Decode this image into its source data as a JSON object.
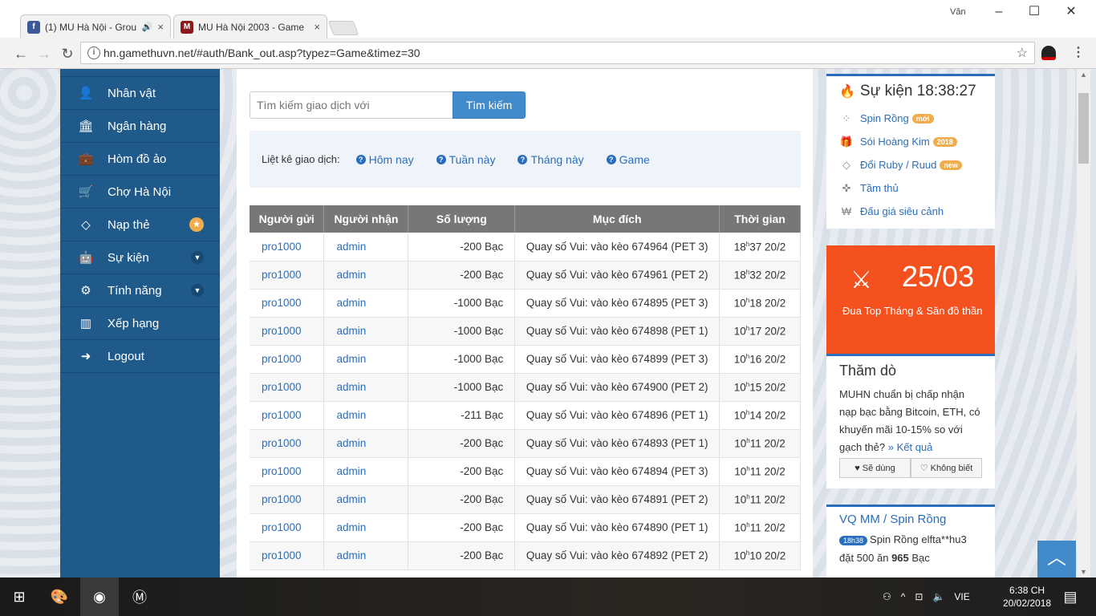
{
  "browser": {
    "tabs": [
      {
        "title": "(1) MU Hà Nội - Grou",
        "favicon": "facebook-icon",
        "color": "#3b5998"
      },
      {
        "title": "MU Hà Nội 2003 - Game",
        "favicon": "mu-icon",
        "color": "#8b1a1a"
      }
    ],
    "user": "Văn",
    "url": "hn.gamethuvn.net/#auth/Bank_out.asp?typez=Game&timez=30"
  },
  "sidebar": {
    "items": [
      {
        "label": "Nhân vật",
        "icon": "user-icon"
      },
      {
        "label": "Ngân hàng",
        "icon": "bank-icon"
      },
      {
        "label": "Hòm đồ ảo",
        "icon": "briefcase-icon"
      },
      {
        "label": "Chợ Hà Nội",
        "icon": "cart-icon"
      },
      {
        "label": "Nạp thẻ",
        "icon": "diamond-icon"
      },
      {
        "label": "Sự kiện",
        "icon": "android-icon"
      },
      {
        "label": "Tính năng",
        "icon": "gears-icon"
      },
      {
        "label": "Xếp hạng",
        "icon": "bar-chart-icon"
      },
      {
        "label": "Logout",
        "icon": "sign-out-icon"
      }
    ]
  },
  "search": {
    "placeholder": "Tìm kiếm giao dịch với",
    "button": "Tìm kiếm"
  },
  "filter": {
    "label": "Liệt kê giao dịch:",
    "links": [
      "Hôm nay",
      "Tuần này",
      "Tháng này",
      "Game"
    ]
  },
  "table": {
    "headers": [
      "Người gửi",
      "Người nhận",
      "Số lượng",
      "Mục đích",
      "Thời gian"
    ],
    "rows": [
      {
        "from": "pro1000",
        "to": "admin",
        "amount": "-200  Bạc",
        "purpose": "Quay số Vui: vào kèo 674964 (PET 3)",
        "hour": "18",
        "time": "37 20/2"
      },
      {
        "from": "pro1000",
        "to": "admin",
        "amount": "-200  Bạc",
        "purpose": "Quay số Vui: vào kèo 674961 (PET 2)",
        "hour": "18",
        "time": "32 20/2"
      },
      {
        "from": "pro1000",
        "to": "admin",
        "amount": "-1000  Bạc",
        "purpose": "Quay số Vui: vào kèo 674895 (PET 3)",
        "hour": "10",
        "time": "18 20/2"
      },
      {
        "from": "pro1000",
        "to": "admin",
        "amount": "-1000  Bạc",
        "purpose": "Quay số Vui: vào kèo 674898 (PET 1)",
        "hour": "10",
        "time": "17 20/2"
      },
      {
        "from": "pro1000",
        "to": "admin",
        "amount": "-1000  Bạc",
        "purpose": "Quay số Vui: vào kèo 674899 (PET 3)",
        "hour": "10",
        "time": "16 20/2"
      },
      {
        "from": "pro1000",
        "to": "admin",
        "amount": "-1000  Bạc",
        "purpose": "Quay số Vui: vào kèo 674900 (PET 2)",
        "hour": "10",
        "time": "15 20/2"
      },
      {
        "from": "pro1000",
        "to": "admin",
        "amount": "-211  Bạc",
        "purpose": "Quay số Vui: vào kèo 674896 (PET 1)",
        "hour": "10",
        "time": "14 20/2"
      },
      {
        "from": "pro1000",
        "to": "admin",
        "amount": "-200  Bạc",
        "purpose": "Quay số Vui: vào kèo 674893 (PET 1)",
        "hour": "10",
        "time": "11 20/2"
      },
      {
        "from": "pro1000",
        "to": "admin",
        "amount": "-200  Bạc",
        "purpose": "Quay số Vui: vào kèo 674894 (PET 3)",
        "hour": "10",
        "time": "11 20/2"
      },
      {
        "from": "pro1000",
        "to": "admin",
        "amount": "-200  Bạc",
        "purpose": "Quay số Vui: vào kèo 674891 (PET 2)",
        "hour": "10",
        "time": "11 20/2"
      },
      {
        "from": "pro1000",
        "to": "admin",
        "amount": "-200  Bạc",
        "purpose": "Quay số Vui: vào kèo 674890 (PET 1)",
        "hour": "10",
        "time": "11 20/2"
      },
      {
        "from": "pro1000",
        "to": "admin",
        "amount": "-200  Bạc",
        "purpose": "Quay số Vui: vào kèo 674892 (PET 2)",
        "hour": "10",
        "time": "10 20/2"
      }
    ]
  },
  "event": {
    "title": "Sự kiện 18:38:27",
    "links": [
      {
        "label": "Spin Rồng",
        "badge": "mới",
        "icon": "spinner-icon"
      },
      {
        "label": "Sói Hoàng Kim",
        "badge": "2018",
        "icon": "gift-icon"
      },
      {
        "label": "Đổi Ruby / Ruud",
        "badge": "new",
        "icon": "diamond-icon"
      },
      {
        "label": "Tầm thủ",
        "badge": "",
        "icon": "crosshair-icon"
      },
      {
        "label": "Đấu giá siêu cảnh",
        "badge": "",
        "icon": "won-icon"
      }
    ]
  },
  "promo": {
    "date": "25/03",
    "text": "Đua Top Tháng & Săn đồ thần",
    "color": "#f4511e"
  },
  "poll": {
    "title": "Thăm dò",
    "question": "MUHN chuẩn bị chấp nhận nạp bạc bằng Bitcoin, ETH, có khuyến mãi 10-15% so với gạch thẻ?",
    "result": "» Kết quả",
    "btn_yes": "Sẽ dùng",
    "btn_no": "Không biết"
  },
  "vq": {
    "title": "VQ MM / Spin Rồng",
    "badge": "18h38",
    "line1": "Spin Rồng elfta**hu3",
    "line2_pre": "đặt 500 ăn ",
    "line2_num": "965",
    "line2_post": " Bạc"
  },
  "taskbar": {
    "lang": "VIE",
    "time": "6:38 CH",
    "date": "20/02/2018"
  },
  "colors": {
    "accent": "#428bca",
    "sidebar": "#1f5a8b",
    "table_header": "#777777"
  }
}
